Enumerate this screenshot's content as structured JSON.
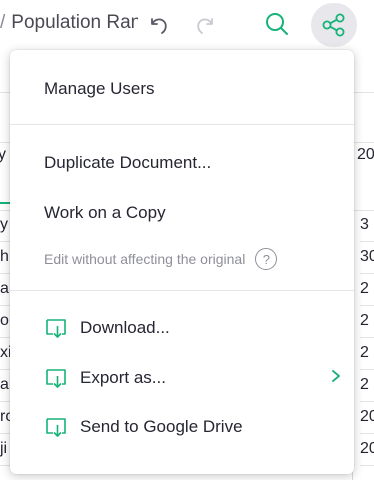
{
  "header": {
    "breadcrumb_sep": "/",
    "doc_title": "Population Ran"
  },
  "grid": {
    "visible_col_header_left": "y",
    "visible_col_header_right": "20",
    "left_fragments": [
      "y",
      "h",
      "ar",
      "o",
      "xi",
      "al",
      "ro",
      "ji"
    ],
    "right_fragments": [
      "3",
      "30",
      "2",
      "2",
      "2",
      "2",
      "20",
      "20"
    ]
  },
  "menu": {
    "manage_users": "Manage Users",
    "duplicate_document": "Duplicate Document...",
    "work_on_copy": "Work on a Copy",
    "work_on_copy_hint": "Edit without affecting the original",
    "hint_icon": "?",
    "download": "Download...",
    "export_as": "Export as...",
    "send_to_drive": "Send to Google Drive"
  },
  "colors": {
    "accent": "#16b378",
    "text": "#262633",
    "muted": "#8f8f99"
  },
  "icons": {
    "undo": "undo-icon",
    "redo": "redo-icon",
    "search": "search-icon",
    "share": "share-icon",
    "download": "download-icon",
    "submenu": "chevron-right-icon"
  }
}
